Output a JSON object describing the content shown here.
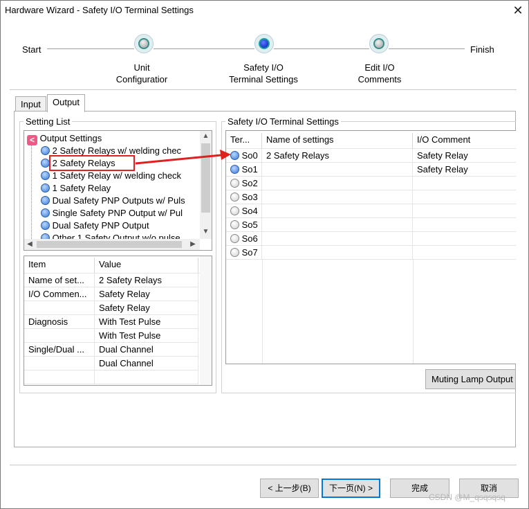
{
  "window": {
    "title": "Hardware Wizard - Safety I/O Terminal Settings",
    "close_label": "✕"
  },
  "steps": {
    "start": "Start",
    "finish": "Finish",
    "items": [
      {
        "line1": "Unit",
        "line2": "Configuratior",
        "active": false
      },
      {
        "line1": "Safety I/O",
        "line2": "Terminal Settings",
        "active": true
      },
      {
        "line1": "Edit I/O",
        "line2": "Comments",
        "active": false
      }
    ]
  },
  "tabs": {
    "input": "Input",
    "output": "Output"
  },
  "setting_list": {
    "title": "Setting List",
    "root": "Output Settings",
    "items": [
      "2 Safety Relays w/ welding chec",
      "2 Safety Relays",
      "1 Safety Relay w/ welding check",
      "1 Safety Relay",
      "Dual Safety PNP Outputs w/ Puls",
      "Single Safety PNP Output w/ Pul",
      "Dual Safety PNP Output",
      "Other 1 Safety Output w/o pulse"
    ],
    "root_icon": "pink-chevron-icon"
  },
  "properties": {
    "headers": [
      "Item",
      "Value"
    ],
    "rows": [
      [
        "Name of set...",
        "2 Safety Relays"
      ],
      [
        "I/O Commen...",
        "Safety Relay"
      ],
      [
        "",
        "Safety Relay"
      ],
      [
        "Diagnosis",
        "With Test Pulse"
      ],
      [
        "",
        "With Test Pulse"
      ],
      [
        "Single/Dual ...",
        "Dual Channel"
      ],
      [
        "",
        "Dual Channel"
      ]
    ]
  },
  "terminal_settings": {
    "title": "Safety I/O Terminal Settings",
    "headers": [
      "Ter...",
      "Name of settings",
      "I/O Comment"
    ],
    "rows": [
      {
        "terminal": "So0",
        "name": "2 Safety Relays",
        "comment": "Safety Relay",
        "state": "blue"
      },
      {
        "terminal": "So1",
        "name": "",
        "comment": "Safety Relay",
        "state": "blue"
      },
      {
        "terminal": "So2",
        "name": "",
        "comment": "",
        "state": "gray"
      },
      {
        "terminal": "So3",
        "name": "",
        "comment": "",
        "state": "gray"
      },
      {
        "terminal": "So4",
        "name": "",
        "comment": "",
        "state": "gray"
      },
      {
        "terminal": "So5",
        "name": "",
        "comment": "",
        "state": "gray"
      },
      {
        "terminal": "So6",
        "name": "",
        "comment": "",
        "state": "gray"
      },
      {
        "terminal": "So7",
        "name": "",
        "comment": "",
        "state": "gray"
      }
    ],
    "muting_button": "Muting Lamp Output"
  },
  "buttons": {
    "back": "< 上一步(B)",
    "next": "下一页(N) >",
    "finish": "完成",
    "cancel": "取消"
  },
  "watermark": "CSDN @M_qsqsqsq",
  "colors": {
    "highlight_box": "#e02020",
    "arrow": "#e02020",
    "active_step": "#0016b8"
  }
}
